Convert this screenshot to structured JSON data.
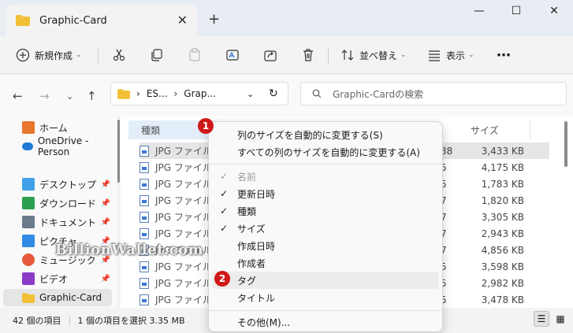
{
  "window": {
    "tab_title": "Graphic-Card",
    "new_tab": "+",
    "close_tab": "✕",
    "minimize": "—",
    "maximize": "☐",
    "close": "✕"
  },
  "toolbar": {
    "new_label": "新規作成",
    "sort_label": "並べ替え",
    "view_label": "表示",
    "more": "⋯"
  },
  "address": {
    "seg1": "ES...",
    "seg2": "Grap...",
    "chev": "›",
    "search_placeholder": "Graphic-Cardの検索"
  },
  "sidebar": {
    "items": [
      {
        "label": "ホーム",
        "icon": "home-icon",
        "color": "#e8762c"
      },
      {
        "label": "OneDrive - Person",
        "icon": "onedrive-icon",
        "color": "#1e7ad6"
      },
      {
        "label": "デスクトップ",
        "icon": "desktop-icon",
        "color": "#3fa0e8"
      },
      {
        "label": "ダウンロード",
        "icon": "download-icon",
        "color": "#2aa050"
      },
      {
        "label": "ドキュメント",
        "icon": "document-icon",
        "color": "#6a7b8c"
      },
      {
        "label": "ピクチャ",
        "icon": "pictures-icon",
        "color": "#2f8be6"
      },
      {
        "label": "ミュージック",
        "icon": "music-icon",
        "color": "#e85a3c"
      },
      {
        "label": "ビデオ",
        "icon": "video-icon",
        "color": "#8a3cc8"
      },
      {
        "label": "Graphic-Card",
        "icon": "folder-icon",
        "color": "#f2c037"
      }
    ]
  },
  "columns": {
    "type": "種類",
    "size": "サイズ"
  },
  "files": [
    {
      "type": "JPG ファイル",
      "mid": "38",
      "size": "3,433 KB"
    },
    {
      "type": "JPG ファイル",
      "mid": "5",
      "size": "4,175 KB"
    },
    {
      "type": "JPG ファイル",
      "mid": "5",
      "size": "1,783 KB"
    },
    {
      "type": "JPG ファイル",
      "mid": "7",
      "size": "1,820 KB"
    },
    {
      "type": "JPG ファイル",
      "mid": "7",
      "size": "3,305 KB"
    },
    {
      "type": "JPG ファイル",
      "mid": "7",
      "size": "2,943 KB"
    },
    {
      "type": "JPG ファイル",
      "mid": "7",
      "size": "4,856 KB"
    },
    {
      "type": "JPG ファイル",
      "mid": "5",
      "size": "3,598 KB"
    },
    {
      "type": "JPG ファイル",
      "mid": "5",
      "size": "2,982 KB"
    },
    {
      "type": "JPG ファイル",
      "mid": "5",
      "size": "3,478 KB"
    }
  ],
  "status": {
    "count": "42 個の項目",
    "selection": "1 個の項目を選択 3.35 MB"
  },
  "menu": {
    "resize": "列のサイズを自動的に変更する(S)",
    "resize_all": "すべての列のサイズを自動的に変更する(A)",
    "items": [
      {
        "label": "名前",
        "check": "✓",
        "disabled": true
      },
      {
        "label": "更新日時",
        "check": "✓"
      },
      {
        "label": "種類",
        "check": "✓"
      },
      {
        "label": "サイズ",
        "check": "✓"
      },
      {
        "label": "作成日時",
        "check": ""
      },
      {
        "label": "作成者",
        "check": ""
      },
      {
        "label": "タグ",
        "check": ""
      },
      {
        "label": "タイトル",
        "check": ""
      }
    ],
    "more": "その他(M)..."
  },
  "badges": {
    "one": "1",
    "two": "2"
  },
  "watermark": "BillionWallet.com"
}
